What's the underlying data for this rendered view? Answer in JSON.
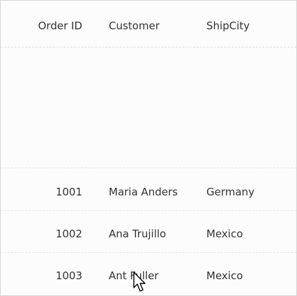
{
  "grid": {
    "columns": [
      {
        "header": "Order ID"
      },
      {
        "header": "Customer"
      },
      {
        "header": "ShipCity"
      }
    ],
    "rows": [
      {
        "order_id": "1001",
        "customer": "Maria Anders",
        "ship_city": "Germany"
      },
      {
        "order_id": "1002",
        "customer": "Ana Trujillo",
        "ship_city": "Mexico"
      },
      {
        "order_id": "1003",
        "customer": "Ant Fuller",
        "ship_city": "Mexico"
      }
    ]
  },
  "cursor": {
    "icon": "mouse-pointer-icon"
  }
}
